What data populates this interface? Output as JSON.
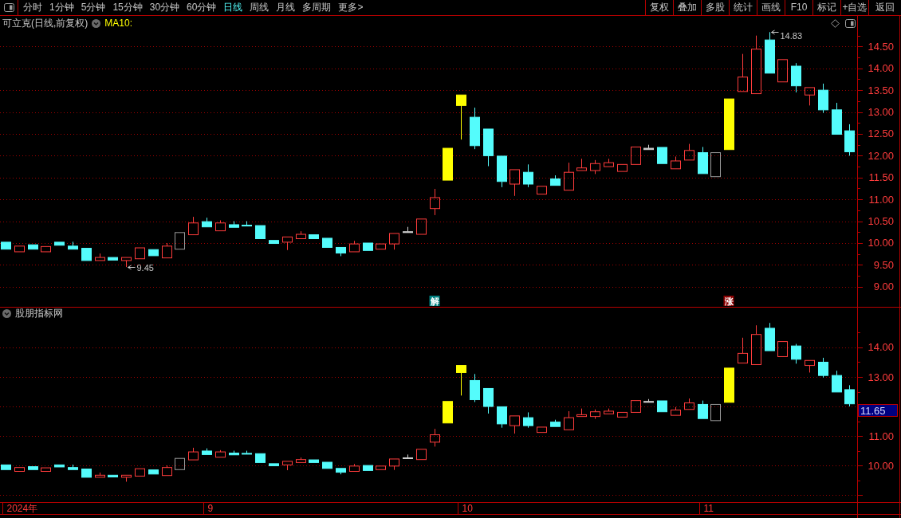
{
  "toolbar": {
    "periods": [
      {
        "label": "分时",
        "selected": false
      },
      {
        "label": "1分钟",
        "selected": false
      },
      {
        "label": "5分钟",
        "selected": false
      },
      {
        "label": "15分钟",
        "selected": false
      },
      {
        "label": "30分钟",
        "selected": false
      },
      {
        "label": "60分钟",
        "selected": false
      },
      {
        "label": "日线",
        "selected": true
      },
      {
        "label": "周线",
        "selected": false
      },
      {
        "label": "月线",
        "selected": false
      },
      {
        "label": "多周期",
        "selected": false
      },
      {
        "label": "更多>",
        "selected": false
      }
    ],
    "buttons": [
      "复权",
      "叠加",
      "多股",
      "统计",
      "画线",
      "F10",
      "标记",
      "+自选",
      "返回"
    ]
  },
  "price_pane": {
    "title": "可立克(日线,前复权)",
    "indicator": "MA10:",
    "signals": [
      {
        "label": "解",
        "color": "#008080"
      },
      {
        "label": "涨",
        "color": "#8b0000"
      }
    ],
    "chart_data": [
      {
        "type": "candlestick",
        "ylim": [
          8.54,
          15.2
        ],
        "grid": true,
        "yticks": [
          {
            "value": 9,
            "label": "9.00"
          },
          {
            "value": 9.5,
            "label": "9.50"
          },
          {
            "value": 10,
            "label": "10.00"
          },
          {
            "value": 10.5,
            "label": "10.50"
          },
          {
            "value": 11,
            "label": "11.00"
          },
          {
            "value": 11.5,
            "label": "11.50"
          },
          {
            "value": 12,
            "label": "12.00"
          },
          {
            "value": 12.5,
            "label": "12.50"
          },
          {
            "value": 13,
            "label": "13.00"
          },
          {
            "value": 13.5,
            "label": "13.50"
          },
          {
            "value": 14,
            "label": "14.00"
          },
          {
            "value": 14.5,
            "label": "14.50"
          }
        ],
        "annotations": [
          "14.83",
          "9.45"
        ],
        "series": [
          {
            "type": "candlestick",
            "ohlc": [
              [
                10.02,
                10.02,
                9.86,
                9.86
              ],
              [
                9.8,
                9.93,
                9.8,
                9.93
              ],
              [
                9.96,
                9.96,
                9.86,
                9.86
              ],
              [
                9.8,
                9.92,
                9.8,
                9.92
              ],
              [
                10.02,
                10.02,
                9.95,
                9.95
              ],
              [
                9.93,
                10.03,
                9.86,
                9.86
              ],
              [
                9.88,
                9.88,
                9.6,
                9.6
              ],
              [
                9.6,
                9.76,
                9.6,
                9.67
              ],
              [
                9.67,
                9.67,
                9.61,
                9.61
              ],
              [
                9.6,
                9.67,
                9.45,
                9.67
              ],
              [
                9.64,
                9.89,
                9.64,
                9.89
              ],
              [
                9.85,
                9.85,
                9.71,
                9.71
              ],
              [
                9.66,
                10.0,
                9.66,
                9.93
              ],
              [
                9.86,
                10.24,
                9.86,
                10.24
              ],
              [
                10.19,
                10.6,
                10.19,
                10.46
              ],
              [
                10.49,
                10.58,
                10.37,
                10.37
              ],
              [
                10.28,
                10.52,
                10.28,
                10.46
              ],
              [
                10.42,
                10.5,
                10.36,
                10.36
              ],
              [
                10.41,
                10.5,
                10.39,
                10.39
              ],
              [
                10.4,
                10.4,
                10.1,
                10.1
              ],
              [
                10.06,
                10.06,
                9.99,
                9.99
              ],
              [
                10.02,
                10.14,
                9.84,
                10.14
              ],
              [
                10.1,
                10.27,
                10.1,
                10.2
              ],
              [
                10.19,
                10.19,
                10.1,
                10.1
              ],
              [
                10.11,
                10.11,
                9.9,
                9.9
              ],
              [
                9.9,
                9.9,
                9.7,
                9.77
              ],
              [
                9.8,
                10.05,
                9.8,
                9.98
              ],
              [
                10.0,
                10.0,
                9.83,
                9.83
              ],
              [
                9.86,
                9.98,
                9.86,
                9.98
              ],
              [
                9.98,
                10.22,
                9.85,
                10.22
              ],
              [
                10.26,
                10.37,
                10.24,
                10.24
              ],
              [
                10.2,
                10.55,
                10.2,
                10.55
              ],
              [
                10.79,
                11.24,
                10.64,
                11.04
              ],
              null,
              null,
              [
                12.88,
                13.1,
                12.15,
                12.23
              ],
              [
                12.61,
                12.61,
                11.76,
                12.0
              ],
              [
                11.99,
                11.99,
                11.28,
                11.41
              ],
              [
                11.35,
                11.68,
                11.08,
                11.68
              ],
              [
                11.62,
                11.8,
                11.28,
                11.35
              ],
              [
                11.12,
                11.3,
                11.12,
                11.3
              ],
              [
                11.47,
                11.55,
                11.32,
                11.32
              ],
              [
                11.21,
                11.84,
                11.21,
                11.62
              ],
              [
                11.66,
                11.93,
                11.66,
                11.72
              ],
              [
                11.66,
                11.9,
                11.58,
                11.82
              ],
              [
                11.75,
                11.93,
                11.75,
                11.84
              ],
              [
                11.64,
                11.8,
                11.64,
                11.8
              ],
              [
                11.8,
                12.2,
                11.8,
                12.2
              ],
              [
                12.17,
                12.25,
                12.14,
                12.14
              ],
              [
                12.19,
                12.19,
                11.82,
                11.82
              ],
              [
                11.7,
                11.98,
                11.7,
                11.88
              ],
              [
                11.9,
                12.27,
                11.9,
                12.12
              ],
              [
                12.07,
                12.2,
                11.59,
                11.59
              ],
              [
                11.52,
                12.07,
                11.52,
                12.07
              ],
              null,
              [
                13.47,
                14.33,
                13.47,
                13.8
              ],
              [
                13.42,
                14.75,
                13.42,
                14.44
              ],
              [
                14.65,
                14.83,
                13.89,
                13.89
              ],
              [
                13.69,
                14.2,
                13.69,
                14.2
              ],
              [
                14.05,
                14.12,
                13.45,
                13.6
              ],
              [
                13.39,
                13.56,
                13.15,
                13.56
              ],
              [
                13.5,
                13.65,
                12.98,
                13.05
              ],
              [
                13.05,
                13.21,
                12.49,
                12.49
              ],
              [
                12.57,
                12.72,
                12.0,
                12.09
              ]
            ],
            "colors": [
              "#54fcfc",
              "#ff3c3c",
              "#54fcfc",
              "#ff3c3c",
              "#54fcfc",
              "#54fcfc",
              "#54fcfc",
              "#ff3c3c",
              "#54fcfc",
              "#ff3c3c",
              "#ff3c3c",
              "#54fcfc",
              "#ff3c3c",
              "#9a9a9a",
              "#ff3c3c",
              "#54fcfc",
              "#ff3c3c",
              "#54fcfc",
              "#54fcfc",
              "#54fcfc",
              "#54fcfc",
              "#ff3c3c",
              "#ff3c3c",
              "#54fcfc",
              "#54fcfc",
              "#54fcfc",
              "#ff3c3c",
              "#54fcfc",
              "#ff3c3c",
              "#ff3c3c",
              "#d0d0d0",
              "#ff3c3c",
              "#ff3c3c",
              null,
              null,
              "#54fcfc",
              "#54fcfc",
              "#54fcfc",
              "#ff3c3c",
              "#54fcfc",
              "#ff3c3c",
              "#54fcfc",
              "#ff3c3c",
              "#ff3c3c",
              "#ff3c3c",
              "#ff3c3c",
              "#ff3c3c",
              "#ff3c3c",
              "#d0d0d0",
              "#54fcfc",
              "#ff3c3c",
              "#ff3c3c",
              "#54fcfc",
              "#9a9a9a",
              null,
              "#ff3c3c",
              "#ff3c3c",
              "#54fcfc",
              "#ff3c3c",
              "#54fcfc",
              "#ff3c3c",
              "#54fcfc",
              "#54fcfc",
              "#54fcfc"
            ]
          },
          {
            "type": "candlestick",
            "color": "#ffff00",
            "ohlc": [
              null,
              null,
              null,
              null,
              null,
              null,
              null,
              null,
              null,
              null,
              null,
              null,
              null,
              null,
              null,
              null,
              null,
              null,
              null,
              null,
              null,
              null,
              null,
              null,
              null,
              null,
              null,
              null,
              null,
              null,
              null,
              null,
              null,
              [
                11.44,
                12.17,
                11.44,
                12.17
              ],
              null,
              null,
              null,
              null,
              null,
              null,
              null,
              null,
              null,
              null,
              null,
              null,
              null,
              null,
              null,
              null,
              null,
              null,
              null,
              null,
              [
                12.14,
                13.3,
                12.14,
                13.3
              ],
              null,
              null,
              null,
              null,
              null,
              null,
              null,
              null,
              null
            ]
          },
          {
            "type": "candlestick",
            "color": "#ffff00",
            "ohlc": [
              null,
              null,
              null,
              null,
              null,
              null,
              null,
              null,
              null,
              null,
              null,
              null,
              null,
              null,
              null,
              null,
              null,
              null,
              null,
              null,
              null,
              null,
              null,
              null,
              null,
              null,
              null,
              null,
              null,
              null,
              null,
              null,
              null,
              null,
              [
                13.39,
                13.39,
                12.37,
                13.15
              ],
              null,
              null,
              null,
              null,
              null,
              null,
              null,
              null,
              null,
              null,
              null,
              null,
              null,
              null,
              null,
              null,
              null,
              null,
              null,
              null,
              null,
              null,
              null,
              null,
              null,
              null,
              null,
              null
            ]
          }
        ]
      }
    ]
  },
  "indicator_pane": {
    "title": "股朋指标网",
    "value_label": "11.65",
    "date_labels": [
      "2024年",
      "9",
      "10",
      "11"
    ],
    "chart_data": [
      {
        "type": "candlestick",
        "ylim": [
          8.76,
          15.35
        ],
        "grid": true,
        "yticks": [
          {
            "value": 10,
            "label": "10.00"
          },
          {
            "value": 11,
            "label": "11.00"
          },
          {
            "value": 13,
            "label": "13.00"
          },
          {
            "value": 14,
            "label": "14.00"
          }
        ],
        "series": [
          {
            "type": "candlestick",
            "ohlc": [
              [
                10.02,
                10.02,
                9.86,
                9.86
              ],
              [
                9.8,
                9.93,
                9.8,
                9.93
              ],
              [
                9.96,
                9.96,
                9.86,
                9.86
              ],
              [
                9.8,
                9.92,
                9.8,
                9.92
              ],
              [
                10.02,
                10.02,
                9.95,
                9.95
              ],
              [
                9.93,
                10.03,
                9.86,
                9.86
              ],
              [
                9.88,
                9.88,
                9.6,
                9.6
              ],
              [
                9.6,
                9.76,
                9.6,
                9.67
              ],
              [
                9.67,
                9.67,
                9.61,
                9.61
              ],
              [
                9.6,
                9.67,
                9.45,
                9.67
              ],
              [
                9.64,
                9.89,
                9.64,
                9.89
              ],
              [
                9.85,
                9.85,
                9.71,
                9.71
              ],
              [
                9.66,
                10.0,
                9.66,
                9.93
              ],
              [
                9.86,
                10.24,
                9.86,
                10.24
              ],
              [
                10.19,
                10.6,
                10.19,
                10.46
              ],
              [
                10.49,
                10.58,
                10.37,
                10.37
              ],
              [
                10.28,
                10.52,
                10.28,
                10.46
              ],
              [
                10.42,
                10.5,
                10.36,
                10.36
              ],
              [
                10.41,
                10.5,
                10.39,
                10.39
              ],
              [
                10.4,
                10.4,
                10.1,
                10.1
              ],
              [
                10.06,
                10.06,
                9.99,
                9.99
              ],
              [
                10.02,
                10.14,
                9.84,
                10.14
              ],
              [
                10.1,
                10.27,
                10.1,
                10.2
              ],
              [
                10.19,
                10.19,
                10.1,
                10.1
              ],
              [
                10.11,
                10.11,
                9.9,
                9.9
              ],
              [
                9.9,
                9.9,
                9.7,
                9.77
              ],
              [
                9.8,
                10.05,
                9.8,
                9.98
              ],
              [
                10.0,
                10.0,
                9.83,
                9.83
              ],
              [
                9.86,
                9.98,
                9.86,
                9.98
              ],
              [
                9.98,
                10.22,
                9.85,
                10.22
              ],
              [
                10.26,
                10.37,
                10.24,
                10.24
              ],
              [
                10.2,
                10.55,
                10.2,
                10.55
              ],
              [
                10.79,
                11.24,
                10.64,
                11.04
              ],
              null,
              null,
              [
                12.88,
                13.1,
                12.15,
                12.23
              ],
              [
                12.61,
                12.61,
                11.76,
                12.0
              ],
              [
                11.99,
                11.99,
                11.28,
                11.41
              ],
              [
                11.35,
                11.68,
                11.08,
                11.68
              ],
              [
                11.62,
                11.8,
                11.28,
                11.35
              ],
              [
                11.12,
                11.3,
                11.12,
                11.3
              ],
              [
                11.47,
                11.55,
                11.32,
                11.32
              ],
              [
                11.21,
                11.84,
                11.21,
                11.62
              ],
              [
                11.66,
                11.93,
                11.66,
                11.72
              ],
              [
                11.66,
                11.9,
                11.58,
                11.82
              ],
              [
                11.75,
                11.93,
                11.75,
                11.84
              ],
              [
                11.64,
                11.8,
                11.64,
                11.8
              ],
              [
                11.8,
                12.2,
                11.8,
                12.2
              ],
              [
                12.17,
                12.25,
                12.14,
                12.14
              ],
              [
                12.19,
                12.19,
                11.82,
                11.82
              ],
              [
                11.7,
                11.98,
                11.7,
                11.88
              ],
              [
                11.9,
                12.27,
                11.9,
                12.12
              ],
              [
                12.07,
                12.2,
                11.59,
                11.59
              ],
              [
                11.52,
                12.07,
                11.52,
                12.07
              ],
              null,
              [
                13.47,
                14.33,
                13.47,
                13.8
              ],
              [
                13.42,
                14.75,
                13.42,
                14.44
              ],
              [
                14.65,
                14.83,
                13.89,
                13.89
              ],
              [
                13.69,
                14.2,
                13.69,
                14.2
              ],
              [
                14.05,
                14.12,
                13.45,
                13.6
              ],
              [
                13.39,
                13.56,
                13.15,
                13.56
              ],
              [
                13.5,
                13.65,
                12.98,
                13.05
              ],
              [
                13.05,
                13.21,
                12.49,
                12.49
              ],
              [
                12.57,
                12.72,
                12.0,
                12.09
              ]
            ],
            "colors": [
              "#54fcfc",
              "#ff3c3c",
              "#54fcfc",
              "#ff3c3c",
              "#54fcfc",
              "#54fcfc",
              "#54fcfc",
              "#ff3c3c",
              "#54fcfc",
              "#ff3c3c",
              "#ff3c3c",
              "#54fcfc",
              "#ff3c3c",
              "#9a9a9a",
              "#ff3c3c",
              "#54fcfc",
              "#ff3c3c",
              "#54fcfc",
              "#54fcfc",
              "#54fcfc",
              "#54fcfc",
              "#ff3c3c",
              "#ff3c3c",
              "#54fcfc",
              "#54fcfc",
              "#54fcfc",
              "#ff3c3c",
              "#54fcfc",
              "#ff3c3c",
              "#ff3c3c",
              "#d0d0d0",
              "#ff3c3c",
              "#ff3c3c",
              null,
              null,
              "#54fcfc",
              "#54fcfc",
              "#54fcfc",
              "#ff3c3c",
              "#54fcfc",
              "#ff3c3c",
              "#54fcfc",
              "#ff3c3c",
              "#ff3c3c",
              "#ff3c3c",
              "#ff3c3c",
              "#ff3c3c",
              "#ff3c3c",
              "#d0d0d0",
              "#54fcfc",
              "#ff3c3c",
              "#ff3c3c",
              "#54fcfc",
              "#9a9a9a",
              null,
              "#ff3c3c",
              "#ff3c3c",
              "#54fcfc",
              "#ff3c3c",
              "#54fcfc",
              "#ff3c3c",
              "#54fcfc",
              "#54fcfc",
              "#54fcfc"
            ]
          },
          {
            "type": "candlestick",
            "color": "#ffff00",
            "ohlc": [
              null,
              null,
              null,
              null,
              null,
              null,
              null,
              null,
              null,
              null,
              null,
              null,
              null,
              null,
              null,
              null,
              null,
              null,
              null,
              null,
              null,
              null,
              null,
              null,
              null,
              null,
              null,
              null,
              null,
              null,
              null,
              null,
              null,
              [
                11.44,
                12.17,
                11.44,
                12.17
              ],
              null,
              null,
              null,
              null,
              null,
              null,
              null,
              null,
              null,
              null,
              null,
              null,
              null,
              null,
              null,
              null,
              null,
              null,
              null,
              null,
              [
                12.14,
                13.3,
                12.14,
                13.3
              ],
              null,
              null,
              null,
              null,
              null,
              null,
              null,
              null,
              null
            ]
          },
          {
            "type": "candlestick",
            "color": "#ffff00",
            "ohlc": [
              null,
              null,
              null,
              null,
              null,
              null,
              null,
              null,
              null,
              null,
              null,
              null,
              null,
              null,
              null,
              null,
              null,
              null,
              null,
              null,
              null,
              null,
              null,
              null,
              null,
              null,
              null,
              null,
              null,
              null,
              null,
              null,
              null,
              null,
              [
                13.39,
                13.39,
                12.37,
                13.15
              ],
              null,
              null,
              null,
              null,
              null,
              null,
              null,
              null,
              null,
              null,
              null,
              null,
              null,
              null,
              null,
              null,
              null,
              null,
              null,
              null,
              null,
              null,
              null,
              null,
              null,
              null,
              null,
              null
            ]
          }
        ]
      }
    ]
  }
}
